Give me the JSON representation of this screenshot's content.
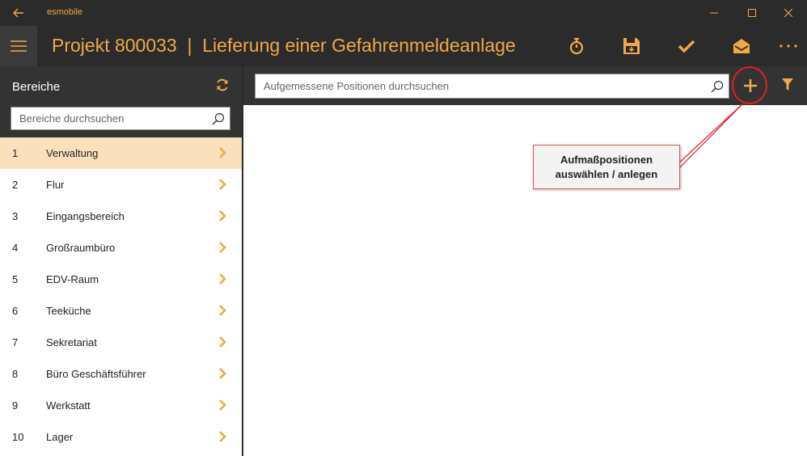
{
  "window": {
    "app_name": "esmobile",
    "controls": [
      "minimize",
      "maximize",
      "close"
    ]
  },
  "appbar": {
    "title": "Projekt 800033  |  Lieferung einer Gefahrenmeldeanlage",
    "actions": [
      "timer-icon",
      "save-icon",
      "check-icon",
      "mail-open-icon",
      "more-icon"
    ]
  },
  "sidebar": {
    "title": "Bereiche",
    "search_placeholder": "Bereiche durchsuchen",
    "items": [
      {
        "num": "1",
        "label": "Verwaltung",
        "selected": true
      },
      {
        "num": "2",
        "label": "Flur"
      },
      {
        "num": "3",
        "label": "Eingangsbereich"
      },
      {
        "num": "4",
        "label": "Großraumbüro"
      },
      {
        "num": "5",
        "label": "EDV-Raum"
      },
      {
        "num": "6",
        "label": "Teeküche"
      },
      {
        "num": "7",
        "label": "Sekretariat"
      },
      {
        "num": "8",
        "label": "Büro Geschäftsführer"
      },
      {
        "num": "9",
        "label": "Werkstatt"
      },
      {
        "num": "10",
        "label": "Lager"
      }
    ]
  },
  "main": {
    "search_placeholder": "Aufgemessene Positionen durchsuchen"
  },
  "callout": {
    "line1": "Aufmaßpositionen",
    "line2": "auswählen / anlegen"
  },
  "colors": {
    "accent": "#f0a848",
    "selected_row": "#fbe0bd",
    "annotation": "#e02020"
  }
}
